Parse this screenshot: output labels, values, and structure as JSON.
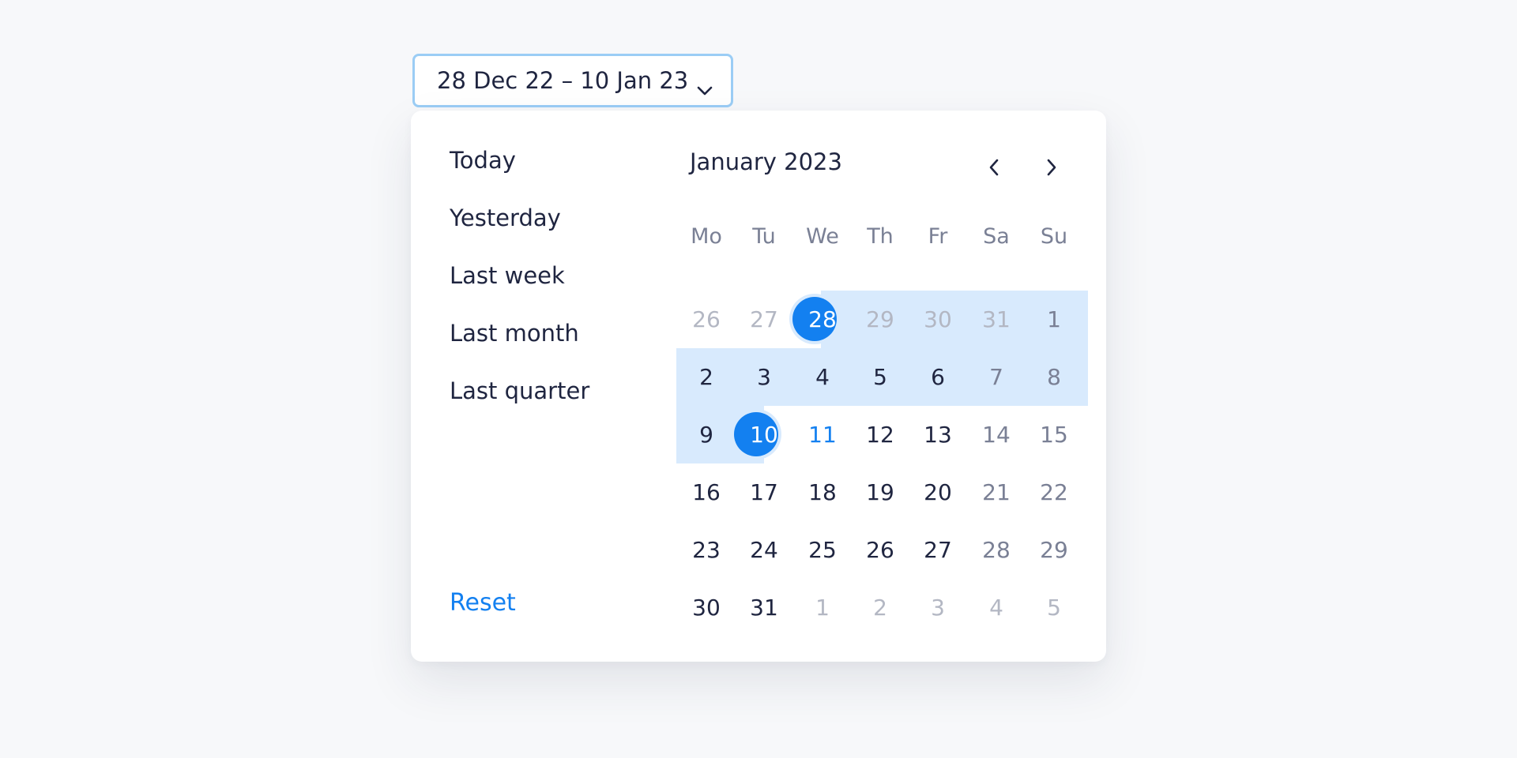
{
  "trigger": {
    "label": "28 Dec 22 – 10 Jan 23",
    "icon": "chevron-down-icon"
  },
  "presets": [
    "Today",
    "Yesterday",
    "Last week",
    "Last month",
    "Last quarter"
  ],
  "reset_label": "Reset",
  "calendar": {
    "month_label": "January 2023",
    "prev_icon": "chevron-left-icon",
    "next_icon": "chevron-right-icon",
    "weekdays": [
      "Mo",
      "Tu",
      "We",
      "Th",
      "Fr",
      "Sa",
      "Su"
    ],
    "range_start": "28 Dec 22",
    "range_end": "10 Jan 23",
    "weeks": [
      [
        {
          "d": "26",
          "s": "out"
        },
        {
          "d": "27",
          "s": "out"
        },
        {
          "d": "28",
          "s": "sel"
        },
        {
          "d": "29",
          "s": "out"
        },
        {
          "d": "30",
          "s": "out"
        },
        {
          "d": "31",
          "s": "out"
        },
        {
          "d": "1",
          "s": "wkd"
        }
      ],
      [
        {
          "d": "2",
          "s": "cur"
        },
        {
          "d": "3",
          "s": "cur"
        },
        {
          "d": "4",
          "s": "cur"
        },
        {
          "d": "5",
          "s": "cur"
        },
        {
          "d": "6",
          "s": "cur"
        },
        {
          "d": "7",
          "s": "wkd"
        },
        {
          "d": "8",
          "s": "wkd"
        }
      ],
      [
        {
          "d": "9",
          "s": "cur"
        },
        {
          "d": "10",
          "s": "sel"
        },
        {
          "d": "11",
          "s": "today"
        },
        {
          "d": "12",
          "s": "cur"
        },
        {
          "d": "13",
          "s": "cur"
        },
        {
          "d": "14",
          "s": "wkd"
        },
        {
          "d": "15",
          "s": "wkd"
        }
      ],
      [
        {
          "d": "16",
          "s": "cur"
        },
        {
          "d": "17",
          "s": "cur"
        },
        {
          "d": "18",
          "s": "cur"
        },
        {
          "d": "19",
          "s": "cur"
        },
        {
          "d": "20",
          "s": "cur"
        },
        {
          "d": "21",
          "s": "wkd"
        },
        {
          "d": "22",
          "s": "wkd"
        }
      ],
      [
        {
          "d": "23",
          "s": "cur"
        },
        {
          "d": "24",
          "s": "cur"
        },
        {
          "d": "25",
          "s": "cur"
        },
        {
          "d": "26",
          "s": "cur"
        },
        {
          "d": "27",
          "s": "cur"
        },
        {
          "d": "28",
          "s": "wkd"
        },
        {
          "d": "29",
          "s": "wkd"
        }
      ],
      [
        {
          "d": "30",
          "s": "cur"
        },
        {
          "d": "31",
          "s": "cur"
        },
        {
          "d": "1",
          "s": "out"
        },
        {
          "d": "2",
          "s": "out"
        },
        {
          "d": "3",
          "s": "out"
        },
        {
          "d": "4",
          "s": "out"
        },
        {
          "d": "5",
          "s": "out"
        }
      ]
    ]
  },
  "colors": {
    "accent": "#1380f0",
    "range": "#d8eafd",
    "text": "#1f2540",
    "muted": "#7a8095",
    "outside": "#b3b7c3"
  }
}
